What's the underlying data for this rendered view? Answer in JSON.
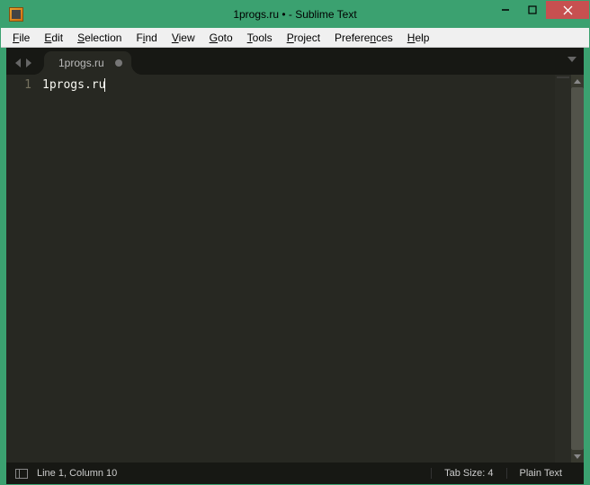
{
  "window": {
    "title": "1progs.ru • - Sublime Text"
  },
  "menu": {
    "items": [
      {
        "label": "File",
        "accel": "F"
      },
      {
        "label": "Edit",
        "accel": "E"
      },
      {
        "label": "Selection",
        "accel": "S"
      },
      {
        "label": "Find",
        "accel": "i"
      },
      {
        "label": "View",
        "accel": "V"
      },
      {
        "label": "Goto",
        "accel": "G"
      },
      {
        "label": "Tools",
        "accel": "T"
      },
      {
        "label": "Project",
        "accel": "P"
      },
      {
        "label": "Preferences",
        "accel": "n"
      },
      {
        "label": "Help",
        "accel": "H"
      }
    ]
  },
  "tabs": {
    "active": {
      "label": "1progs.ru",
      "dirty": true
    }
  },
  "editor": {
    "gutter": [
      "1"
    ],
    "lines": [
      "1progs.ru"
    ]
  },
  "status": {
    "position": "Line 1, Column 10",
    "tab_size": "Tab Size: 4",
    "syntax": "Plain Text"
  }
}
